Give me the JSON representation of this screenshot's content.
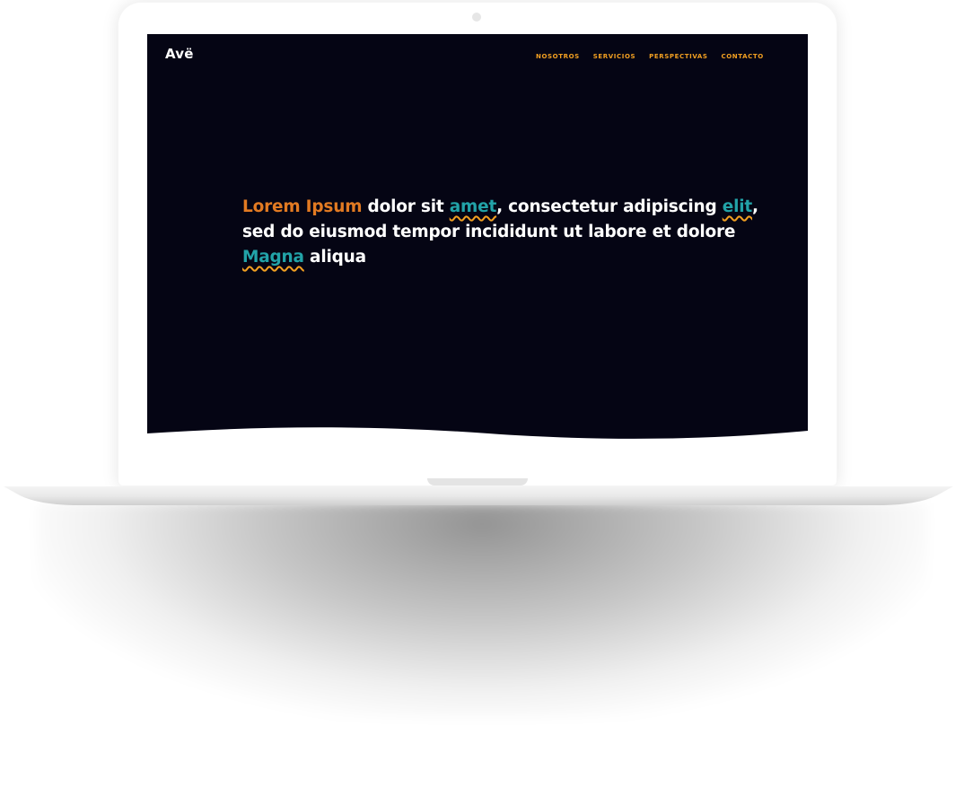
{
  "site": {
    "logo": "Avë"
  },
  "nav": {
    "items": [
      {
        "label": "NOSOTROS"
      },
      {
        "label": "SERVICIOS"
      },
      {
        "label": "PERSPECTIVAS"
      },
      {
        "label": "CONTACTO"
      }
    ]
  },
  "hero": {
    "part1_orange": "Lorem Ipsum",
    "part2": " dolor sit ",
    "word_amet": "amet",
    "part3": ", consectetur adipiscing ",
    "word_elit": "elit",
    "part4": ", sed do eiusmod tempor incididunt ut labore et dolore ",
    "word_magna": "Magna",
    "part5": " aliqua"
  },
  "colors": {
    "background": "#050514",
    "accent_orange": "#e27a22",
    "nav_orange": "#f3a021",
    "accent_teal": "#22a3a8",
    "text": "#ffffff"
  }
}
